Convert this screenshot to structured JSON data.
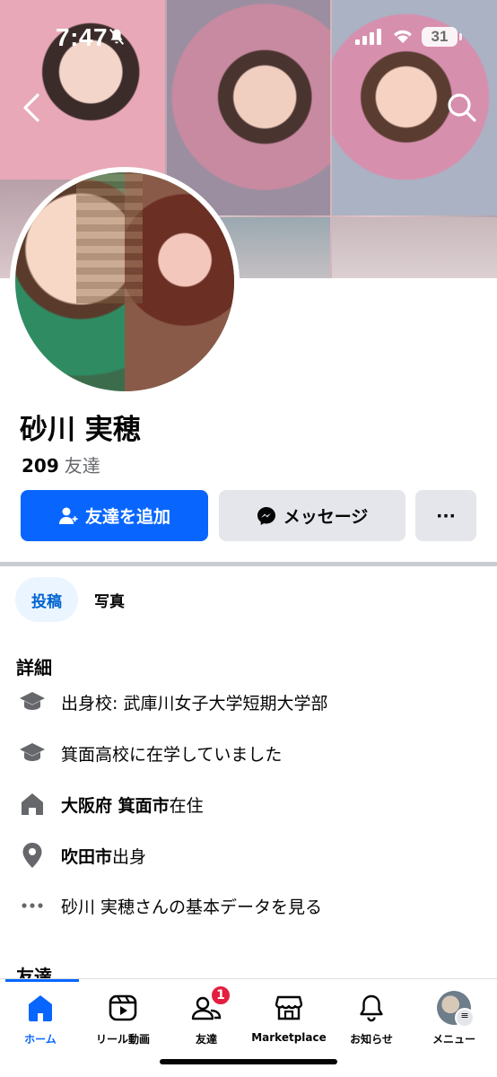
{
  "status_bar": {
    "time": "7:47",
    "battery": "31"
  },
  "profile": {
    "name": "砂川 実穂",
    "friends_count": "209",
    "friends_label": "友達"
  },
  "actions": {
    "add_friend": "友達を追加",
    "message": "メッセージ",
    "more": "···"
  },
  "tabs": [
    {
      "label": "投稿",
      "active": true
    },
    {
      "label": "写真",
      "active": false
    }
  ],
  "details": {
    "title": "詳細",
    "items": [
      {
        "icon": "graduation-cap-icon",
        "prefix": "出身校: 武庫川女子大学短期大学部",
        "bold": "",
        "suffix": ""
      },
      {
        "icon": "graduation-cap-icon",
        "prefix": "箕面高校に在学していました",
        "bold": "",
        "suffix": ""
      },
      {
        "icon": "home-icon",
        "prefix": "",
        "bold": "大阪府 箕面市",
        "suffix": "在住"
      },
      {
        "icon": "location-pin-icon",
        "prefix": "",
        "bold": "吹田市",
        "suffix": "出身"
      },
      {
        "icon": "more-dots-icon",
        "prefix": "砂川 実穂さんの基本データを見る",
        "bold": "",
        "suffix": ""
      }
    ]
  },
  "friends_section_title": "友達",
  "bottom_nav": [
    {
      "label": "ホーム",
      "icon": "home-icon",
      "active": true
    },
    {
      "label": "リール動画",
      "icon": "reels-icon",
      "active": false
    },
    {
      "label": "友達",
      "icon": "friends-icon",
      "active": false,
      "badge": "1"
    },
    {
      "label": "Marketplace",
      "icon": "marketplace-icon",
      "active": false
    },
    {
      "label": "お知らせ",
      "icon": "bell-icon",
      "active": false
    },
    {
      "label": "メニュー",
      "icon": "menu-avatar-icon",
      "active": false
    }
  ],
  "colors": {
    "accent": "#0866ff",
    "button_secondary": "#e4e6eb",
    "tab_active_bg": "#ebf5ff",
    "badge": "#e41e3f",
    "secondary_text": "#65676b"
  }
}
